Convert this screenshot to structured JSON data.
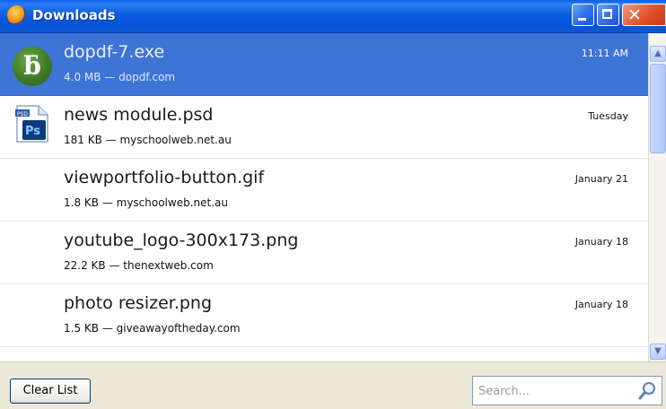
{
  "window": {
    "title": "Downloads",
    "icon": "firefox-icon"
  },
  "titlebar_buttons": [
    "minimize-icon",
    "maximize-icon",
    "close-icon"
  ],
  "downloads": [
    {
      "name": "dopdf-7.exe",
      "meta": "4.0 MB — dopdf.com",
      "date": "11:11 AM",
      "icon": "dopdf-app-icon",
      "selected": true
    },
    {
      "name": "news module.psd",
      "meta": "181 KB — myschoolweb.net.au",
      "date": "Tuesday",
      "icon": "photoshop-file-icon",
      "selected": false
    },
    {
      "name": "viewportfolio-button.gif",
      "meta": "1.8 KB — myschoolweb.net.au",
      "date": "January 21",
      "icon": "",
      "selected": false
    },
    {
      "name": "youtube_logo-300x173.png",
      "meta": "22.2 KB — thenextweb.com",
      "date": "January 18",
      "icon": "",
      "selected": false
    },
    {
      "name": "photo resizer.png",
      "meta": "1.5 KB — giveawayoftheday.com",
      "date": "January 18",
      "icon": "",
      "selected": false
    }
  ],
  "footer": {
    "clear_label": "Clear List",
    "search_placeholder": "Search...",
    "search_value": ""
  },
  "colors": {
    "titlebar": "#0754d8",
    "selection": "#3d74d5",
    "chrome": "#ece9d8"
  }
}
